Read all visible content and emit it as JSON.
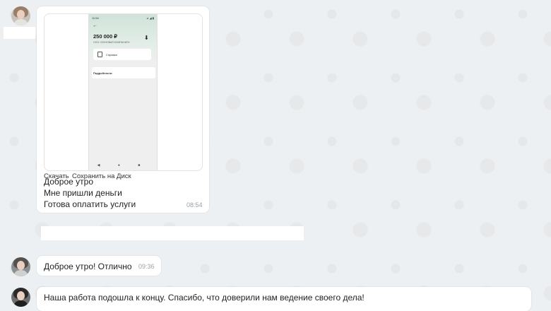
{
  "attachment": {
    "phone": {
      "time": "11:54",
      "signal": "⊿ ◢ ▮",
      "amount": "250 000 ₽",
      "payer": "ООО «ФОНОВАЯ КОМПАНИЯ»",
      "receipt_label": "Справка",
      "details_label": "Подробности",
      "nav": "◀ ● ■"
    },
    "download_label": "Скачать",
    "save_disk_label": "Сохранить на Диск"
  },
  "messages": [
    {
      "lines": [
        "Доброе утро",
        "Мне пришли деньги",
        "Готова оплатить услуги"
      ],
      "time": "08:54"
    },
    {
      "text": "Доброе утро! Отлично",
      "time": "09:36"
    },
    {
      "text": "Наша работа подошла к концу. Спасибо, что доверили нам ведение своего дела!"
    }
  ],
  "colors": {
    "background": "#edf0f2",
    "bubble": "#ffffff",
    "timestamp": "#9aa0a6"
  }
}
